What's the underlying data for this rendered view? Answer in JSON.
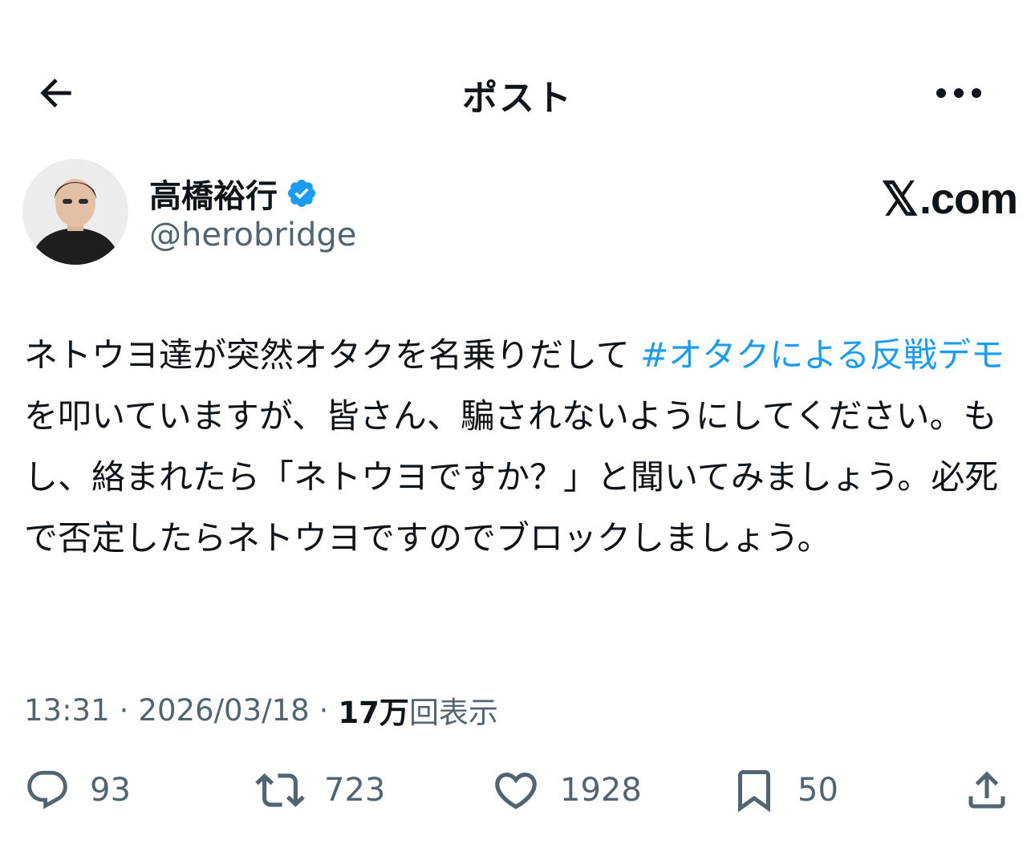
{
  "header": {
    "title": "ポスト"
  },
  "author": {
    "display_name": "高橋裕行",
    "handle": "@herobridge",
    "verified": true,
    "avatar": "avatar-photo"
  },
  "brand": {
    "x_glyph": "𝕏",
    "suffix": ".com"
  },
  "post": {
    "text_before": "ネトウヨ達が突然オタクを名乗りだして ",
    "hashtag": "#オタクによる反戦デモ",
    "text_after": " を叩いていますが、皆さん、騙されないようにしてください。もし、絡まれたら「ネトウヨですか？」と聞いてみましょう。必死で否定したらネトウヨですのでブロックしましょう。"
  },
  "meta": {
    "time": "13:31",
    "separator": "·",
    "date": "2026/03/18",
    "views_count": "17万",
    "views_label": "回表示"
  },
  "actions": {
    "replies": "93",
    "reposts": "723",
    "likes": "1928",
    "bookmarks": "50"
  },
  "colors": {
    "link": "#1d9bf0",
    "verified": "#1d9bf0",
    "secondary_text": "#536471",
    "text": "#0f1419"
  }
}
